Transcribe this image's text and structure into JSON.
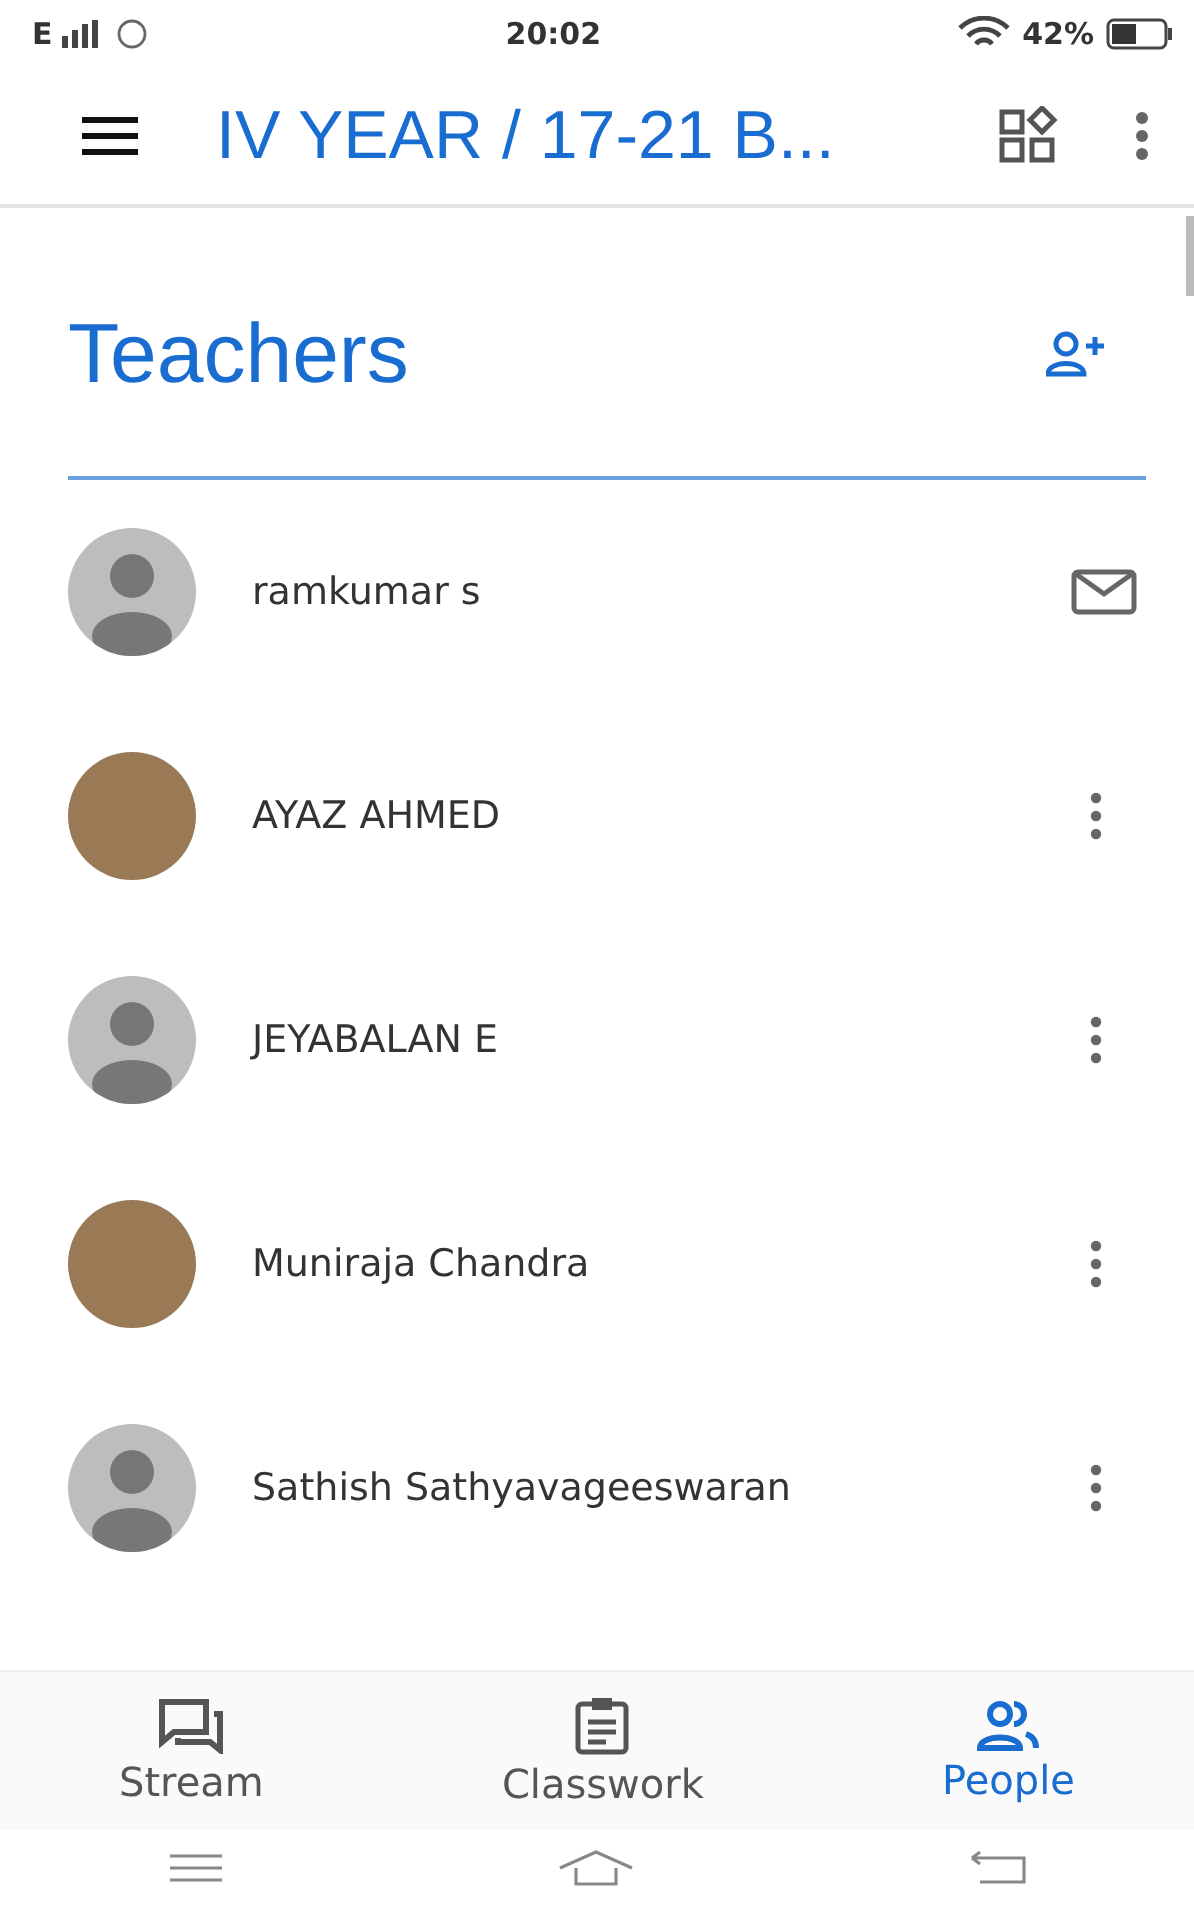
{
  "status_bar": {
    "network": "E",
    "time": "20:02",
    "battery": "42%"
  },
  "app_bar": {
    "title": "IV YEAR / 17-21 B..."
  },
  "section": {
    "title": "Teachers"
  },
  "teachers": [
    {
      "name": "ramkumar s",
      "avatar": {
        "kind": "default"
      },
      "action": {
        "kind": "mail"
      }
    },
    {
      "name": "AYAZ AHMED",
      "avatar": {
        "kind": "photo"
      },
      "action": {
        "kind": "more"
      }
    },
    {
      "name": "JEYABALAN E",
      "avatar": {
        "kind": "default"
      },
      "action": {
        "kind": "more"
      }
    },
    {
      "name": "Muniraja Chandra",
      "avatar": {
        "kind": "photo"
      },
      "action": {
        "kind": "more"
      }
    },
    {
      "name": "Sathish Sathyavageeswaran",
      "avatar": {
        "kind": "default"
      },
      "action": {
        "kind": "more"
      }
    }
  ],
  "tabs": [
    {
      "label": "Stream",
      "kind": "stream",
      "selected": false
    },
    {
      "label": "Classwork",
      "kind": "classwork",
      "selected": false
    },
    {
      "label": "People",
      "kind": "people",
      "selected": true
    }
  ]
}
